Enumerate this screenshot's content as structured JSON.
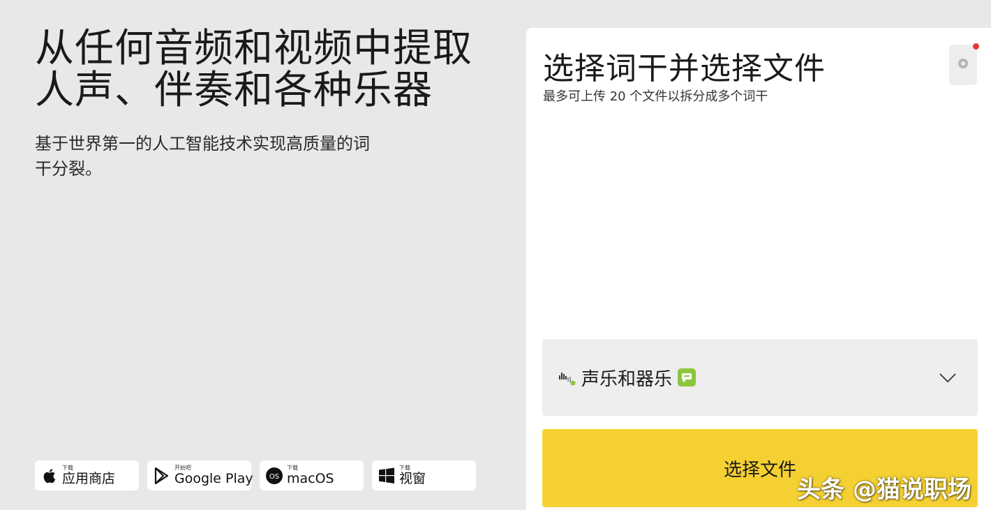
{
  "hero": {
    "title_line1": "从任何音频和视频中提取",
    "title_line2": "人声、伴奏和各种乐器",
    "subtitle_line1": "基于世界第一的人工智能技术实现高质量的词",
    "subtitle_line2": "干分裂。"
  },
  "stores": [
    {
      "icon": "apple-icon",
      "small": "下载",
      "label": "应用商店"
    },
    {
      "icon": "google-play-icon",
      "small": "开始吧",
      "label": "Google Play"
    },
    {
      "icon": "macos-icon",
      "small": "下载",
      "label": "macOS"
    },
    {
      "icon": "windows-icon",
      "small": "下载",
      "label": "视窗"
    }
  ],
  "panel": {
    "title": "选择词干并选择文件",
    "subtitle": "最多可上传 20 个文件以拆分成多个词干",
    "settings_icon": "gear-icon",
    "stem_selector": {
      "icon": "waveform-icon",
      "label": "声乐和器乐",
      "badge_icon": "premium-badge-icon",
      "chevron_icon": "chevron-down-icon"
    },
    "choose_button": "选择文件"
  },
  "colors": {
    "page_bg": "#e8e8e8",
    "panel_bg": "#ffffff",
    "accent_yellow": "#f5d032",
    "badge_green": "#8cc63f",
    "notif_red": "#e53935"
  },
  "watermark": "头条 @猫说职场"
}
